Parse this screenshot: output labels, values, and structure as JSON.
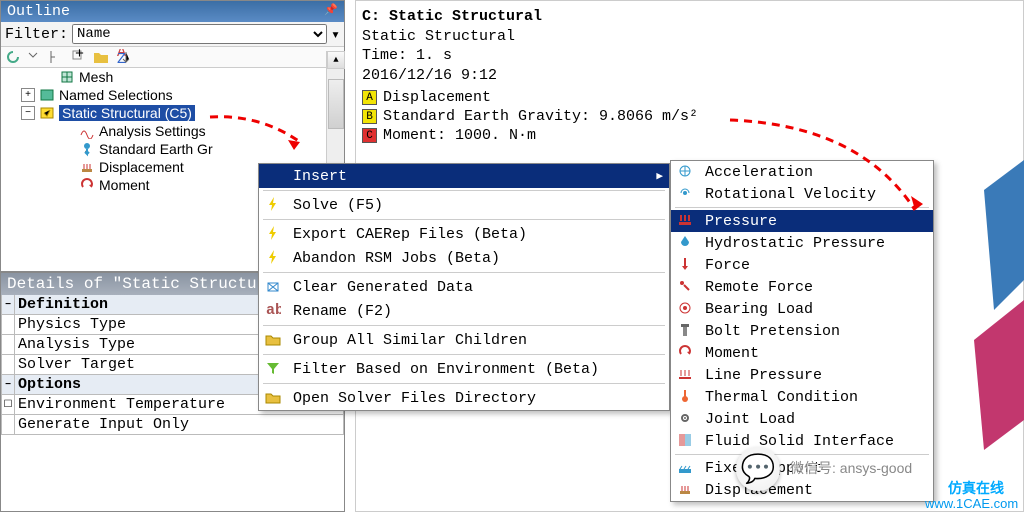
{
  "outline": {
    "title": "Outline",
    "filter_label": "Filter:",
    "filter_value": "Name",
    "tree": [
      {
        "indent": 40,
        "exp": "",
        "icon": "mesh",
        "label": "Mesh"
      },
      {
        "indent": 20,
        "exp": "+",
        "icon": "named",
        "label": "Named Selections"
      },
      {
        "indent": 20,
        "exp": "-",
        "icon": "static",
        "label": "Static Structural (C5)",
        "selected": true
      },
      {
        "indent": 60,
        "exp": "",
        "icon": "analysis",
        "label": "Analysis Settings"
      },
      {
        "indent": 60,
        "exp": "",
        "icon": "gravity",
        "label": "Standard Earth Gr"
      },
      {
        "indent": 60,
        "exp": "",
        "icon": "disp",
        "label": "Displacement"
      },
      {
        "indent": 60,
        "exp": "",
        "icon": "moment",
        "label": "Moment"
      }
    ]
  },
  "details": {
    "title": "Details of \"Static Structur",
    "rows": [
      {
        "type": "header",
        "label": "Definition",
        "exp": "-"
      },
      {
        "type": "row",
        "label": "Physics Type"
      },
      {
        "type": "row",
        "label": "Analysis Type"
      },
      {
        "type": "row",
        "label": "Solver Target"
      },
      {
        "type": "header",
        "label": "Options",
        "exp": "-"
      },
      {
        "type": "row",
        "label": "Environment Temperature",
        "checkbox": true
      },
      {
        "type": "row",
        "label": "Generate Input Only"
      }
    ]
  },
  "info": {
    "title": "C: Static Structural",
    "subtitle": "Static Structural",
    "time": "Time: 1. s",
    "date": "2016/12/16 9:12",
    "legend": [
      {
        "tag": "A",
        "color": "#f2e406",
        "label": "Displacement"
      },
      {
        "tag": "B",
        "color": "#f2e406",
        "label": "Standard Earth Gravity: 9.8066 m/s²"
      },
      {
        "tag": "C",
        "color": "#e03030",
        "label": "Moment: 1000. N·m"
      }
    ]
  },
  "menu1": [
    {
      "label": "Insert",
      "hl": true,
      "arrow": true
    },
    {
      "sep": true
    },
    {
      "icon": "bolt",
      "label": "Solve (F5)"
    },
    {
      "sep": true
    },
    {
      "icon": "bolt",
      "label": "Export CAERep Files (Beta)"
    },
    {
      "icon": "bolt",
      "label": "Abandon RSM Jobs (Beta)"
    },
    {
      "sep": true
    },
    {
      "icon": "clear",
      "label": "Clear Generated Data"
    },
    {
      "icon": "rename",
      "label": "Rename (F2)"
    },
    {
      "sep": true
    },
    {
      "icon": "folder",
      "label": "Group All Similar Children"
    },
    {
      "sep": true
    },
    {
      "icon": "filter",
      "label": "Filter Based on Environment (Beta)"
    },
    {
      "sep": true
    },
    {
      "icon": "folder",
      "label": "Open Solver Files Directory"
    }
  ],
  "menu2": [
    {
      "icon": "accel",
      "label": "Acceleration"
    },
    {
      "icon": "rot",
      "label": "Rotational Velocity"
    },
    {
      "sep": true
    },
    {
      "icon": "press",
      "label": "Pressure",
      "hl": true
    },
    {
      "icon": "hydro",
      "label": "Hydrostatic Pressure"
    },
    {
      "icon": "force",
      "label": "Force"
    },
    {
      "icon": "rforce",
      "label": "Remote Force"
    },
    {
      "icon": "bload",
      "label": "Bearing Load"
    },
    {
      "icon": "pretens",
      "label": "Bolt Pretension"
    },
    {
      "icon": "moment",
      "label": "Moment"
    },
    {
      "icon": "lpress",
      "label": "Line Pressure"
    },
    {
      "icon": "thermal",
      "label": "Thermal Condition"
    },
    {
      "icon": "joint",
      "label": "Joint Load"
    },
    {
      "icon": "fsi",
      "label": "Fluid Solid Interface"
    },
    {
      "sep": true
    },
    {
      "icon": "fixed",
      "label": "Fixed Support"
    },
    {
      "icon": "disp",
      "label": "Displacement"
    }
  ],
  "watermarks": {
    "wx": "微信号: ansys-good",
    "site": "仿真在线",
    "url": "www.1CAE.com"
  }
}
